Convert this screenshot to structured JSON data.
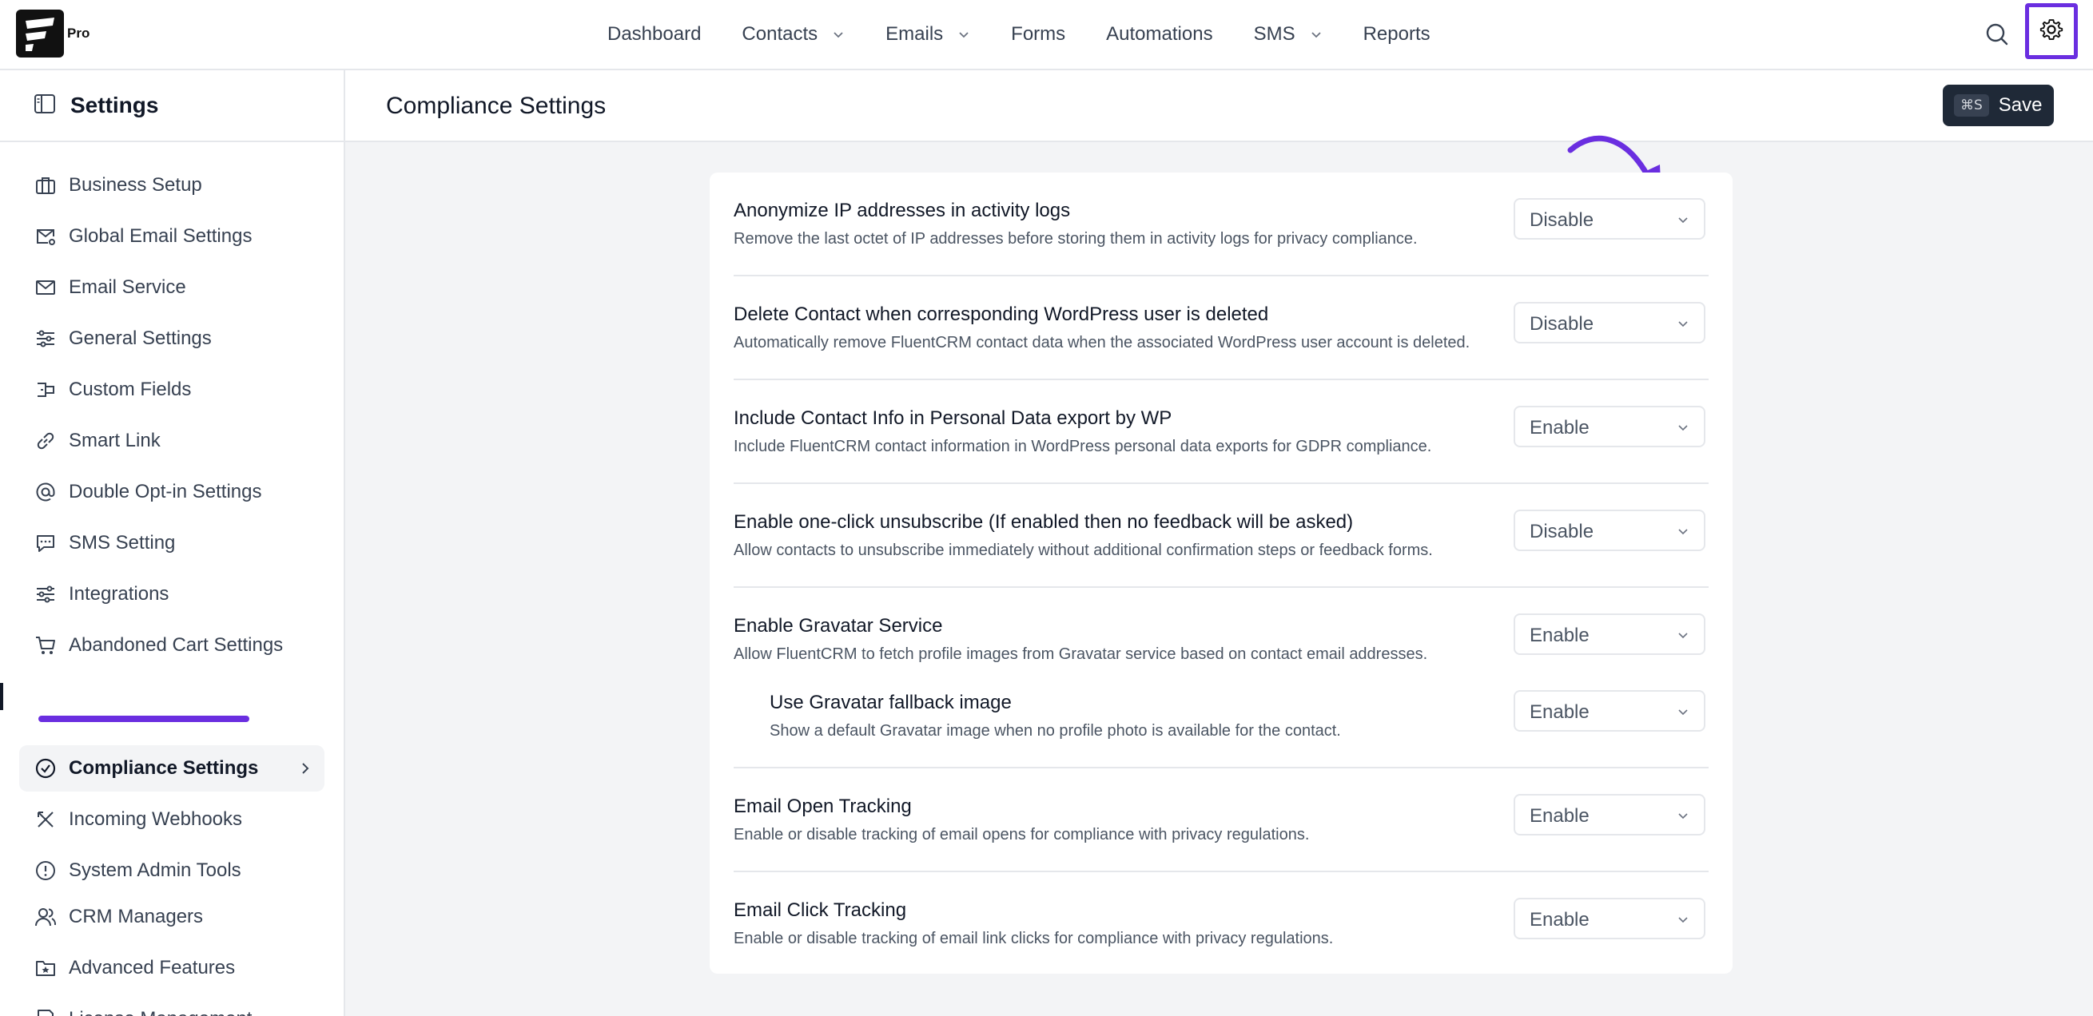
{
  "app": {
    "logo_badge": "Pro"
  },
  "topnav": {
    "items": [
      {
        "label": "Dashboard",
        "dropdown": false
      },
      {
        "label": "Contacts",
        "dropdown": true
      },
      {
        "label": "Emails",
        "dropdown": true
      },
      {
        "label": "Forms",
        "dropdown": false
      },
      {
        "label": "Automations",
        "dropdown": false
      },
      {
        "label": "SMS",
        "dropdown": true
      },
      {
        "label": "Reports",
        "dropdown": false
      }
    ],
    "accent_color": "#6a2ee0"
  },
  "sidebar": {
    "title": "Settings",
    "items": [
      {
        "label": "Business Setup",
        "icon": "briefcase-icon"
      },
      {
        "label": "Global Email Settings",
        "icon": "mail-settings-icon"
      },
      {
        "label": "Email Service",
        "icon": "mail-icon"
      },
      {
        "label": "General Settings",
        "icon": "sliders-icon"
      },
      {
        "label": "Custom Fields",
        "icon": "custom-fields-icon"
      },
      {
        "label": "Smart Link",
        "icon": "link-icon"
      },
      {
        "label": "Double Opt-in Settings",
        "icon": "at-icon"
      },
      {
        "label": "SMS Setting",
        "icon": "message-icon"
      },
      {
        "label": "Integrations",
        "icon": "sliders-icon"
      },
      {
        "label": "Abandoned Cart Settings",
        "icon": "cart-icon"
      },
      {
        "label": "Compliance Settings",
        "icon": "check-circle-icon",
        "active": true
      },
      {
        "label": "Incoming Webhooks",
        "icon": "webhook-icon"
      },
      {
        "label": "System Admin Tools",
        "icon": "alert-circle-icon"
      },
      {
        "label": "CRM Managers",
        "icon": "users-icon"
      },
      {
        "label": "Advanced Features",
        "icon": "star-folder-icon"
      },
      {
        "label": "License Management",
        "icon": "document-icon"
      }
    ]
  },
  "main": {
    "title": "Compliance Settings",
    "save": {
      "shortcut": "⌘S",
      "label": "Save"
    }
  },
  "settings": [
    {
      "title": "Anonymize IP addresses in activity logs",
      "description": "Remove the last octet of IP addresses before storing them in activity logs for privacy compliance.",
      "value": "Disable"
    },
    {
      "title": "Delete Contact when corresponding WordPress user is deleted",
      "description": "Automatically remove FluentCRM contact data when the associated WordPress user account is deleted.",
      "value": "Disable"
    },
    {
      "title": "Include Contact Info in Personal Data export by WP",
      "description": "Include FluentCRM contact information in WordPress personal data exports for GDPR compliance.",
      "value": "Enable"
    },
    {
      "title": "Enable one-click unsubscribe (If enabled then no feedback will be asked)",
      "description": "Allow contacts to unsubscribe immediately without additional confirmation steps or feedback forms.",
      "value": "Disable"
    },
    {
      "title": "Enable Gravatar Service",
      "description": "Allow FluentCRM to fetch profile images from Gravatar service based on contact email addresses.",
      "value": "Enable"
    },
    {
      "title": "Use Gravatar fallback image",
      "description": "Show a default Gravatar image when no profile photo is available for the contact.",
      "value": "Enable",
      "nested": true
    },
    {
      "title": "Email Open Tracking",
      "description": "Enable or disable tracking of email opens for compliance with privacy regulations.",
      "value": "Enable"
    },
    {
      "title": "Email Click Tracking",
      "description": "Enable or disable tracking of email link clicks for compliance with privacy regulations.",
      "value": "Enable"
    }
  ]
}
